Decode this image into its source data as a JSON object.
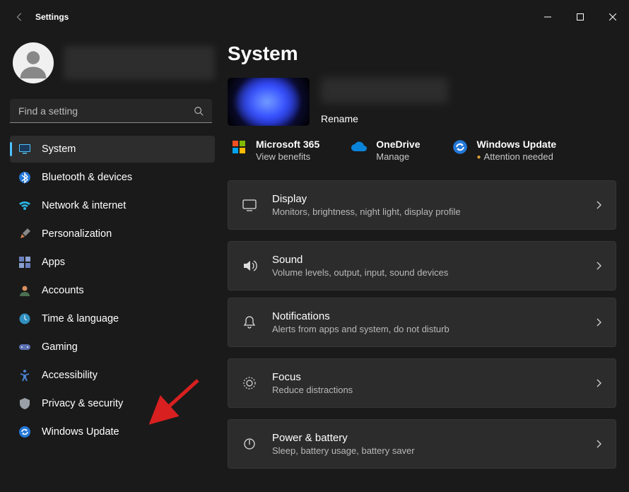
{
  "window": {
    "title": "Settings"
  },
  "search": {
    "placeholder": "Find a setting"
  },
  "nav": {
    "items": [
      {
        "label": "System"
      },
      {
        "label": "Bluetooth & devices"
      },
      {
        "label": "Network & internet"
      },
      {
        "label": "Personalization"
      },
      {
        "label": "Apps"
      },
      {
        "label": "Accounts"
      },
      {
        "label": "Time & language"
      },
      {
        "label": "Gaming"
      },
      {
        "label": "Accessibility"
      },
      {
        "label": "Privacy & security"
      },
      {
        "label": "Windows Update"
      }
    ],
    "selected_index": 0
  },
  "page": {
    "title": "System",
    "device": {
      "rename_label": "Rename"
    },
    "services": {
      "m365": {
        "title": "Microsoft 365",
        "sub": "View benefits"
      },
      "onedrive": {
        "title": "OneDrive",
        "sub": "Manage"
      },
      "update": {
        "title": "Windows Update",
        "sub": "Attention needed"
      }
    },
    "tiles": [
      {
        "title": "Display",
        "sub": "Monitors, brightness, night light, display profile"
      },
      {
        "title": "Sound",
        "sub": "Volume levels, output, input, sound devices"
      },
      {
        "title": "Notifications",
        "sub": "Alerts from apps and system, do not disturb"
      },
      {
        "title": "Focus",
        "sub": "Reduce distractions"
      },
      {
        "title": "Power & battery",
        "sub": "Sleep, battery usage, battery saver"
      }
    ]
  }
}
